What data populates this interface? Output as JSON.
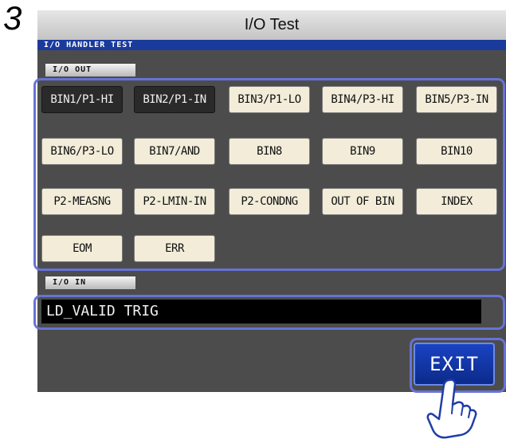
{
  "step_number": "3",
  "window": {
    "title": "I/O Test"
  },
  "screen_header": "I/O HANDLER TEST",
  "io_out": {
    "label": "I/O OUT",
    "buttons": [
      {
        "label": "BIN1/P1-HI",
        "active": true
      },
      {
        "label": "BIN2/P1-IN",
        "active": true
      },
      {
        "label": "BIN3/P1-LO",
        "active": false
      },
      {
        "label": "BIN4/P3-HI",
        "active": false
      },
      {
        "label": "BIN5/P3-IN",
        "active": false
      },
      {
        "label": "BIN6/P3-LO",
        "active": false
      },
      {
        "label": "BIN7/AND",
        "active": false
      },
      {
        "label": "BIN8",
        "active": false
      },
      {
        "label": "BIN9",
        "active": false
      },
      {
        "label": "BIN10",
        "active": false
      },
      {
        "label": "P2-MEASNG",
        "active": false
      },
      {
        "label": "P2-LMIN-IN",
        "active": false
      },
      {
        "label": "P2-CONDNG",
        "active": false
      },
      {
        "label": "OUT OF BIN",
        "active": false
      },
      {
        "label": "INDEX",
        "active": false
      },
      {
        "label": "EOM",
        "active": false
      },
      {
        "label": "ERR",
        "active": false
      }
    ]
  },
  "io_in": {
    "label": "I/O IN",
    "status": "LD_VALID TRIG"
  },
  "exit_label": "EXIT",
  "icons": {
    "pointer": "pointing-hand-icon"
  },
  "colors": {
    "header": "#1a3a9c",
    "highlight_frame": "#6673d6",
    "button": "#f2ecd9",
    "button_active": "#2a2a2a",
    "exit": "#1a43c2",
    "screen": "#4c4c4c"
  }
}
